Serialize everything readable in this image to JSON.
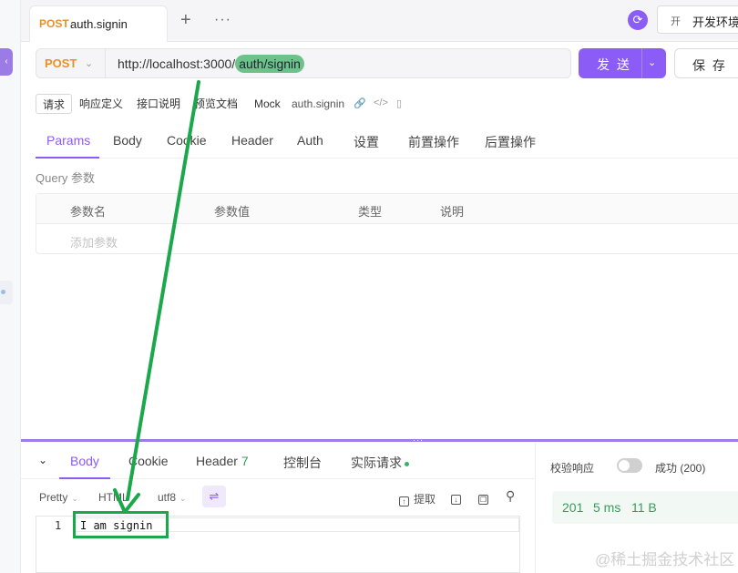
{
  "left_strip": {
    "button_glyph": "‹"
  },
  "tabbar": {
    "file_tab": {
      "method": "POST",
      "name": "auth.signin"
    },
    "add_glyph": "+",
    "more_glyph": "···",
    "sync_glyph": "⟳",
    "env": {
      "icon_text": "开",
      "label": "开发环境"
    }
  },
  "request": {
    "method": "POST",
    "chevron": "⌄",
    "url_base": "http://localhost:3000/",
    "url_path": "auth/signin",
    "send_label": "发 送",
    "save_label": "保 存"
  },
  "subtabs": [
    "请求",
    "响应定义",
    "接口说明",
    "预览文档",
    "Mock",
    "auth.signin"
  ],
  "subtab_icons": [
    "🔗",
    "</>",
    "▯"
  ],
  "req_tabs": [
    "Params",
    "Body",
    "Cookie",
    "Header",
    "Auth",
    "设置",
    "前置操作",
    "后置操作"
  ],
  "params": {
    "label": "Query 参数",
    "headers": [
      "参数名",
      "参数值",
      "类型",
      "说明"
    ],
    "placeholder": "添加参数"
  },
  "response": {
    "collapse_glyph": "⌄",
    "tabs": {
      "body": "Body",
      "cookie": "Cookie",
      "header": "Header",
      "header_count": "7",
      "console": "控制台",
      "actual": "实际请求"
    },
    "format": {
      "pretty": "Pretty",
      "type": "HTML",
      "encoding": "utf8"
    },
    "tools": {
      "extract": "提取"
    },
    "line_number": "1",
    "body_text": "I am signin"
  },
  "validate": {
    "label": "校验响应",
    "status": "成功 (200)",
    "status_code": "201",
    "time": "5 ms",
    "size": "11 B"
  },
  "watermark": "@稀土掘金技术社区",
  "colors": {
    "accent": "#8b5cf6",
    "method_post": "#e8902a",
    "annotation_green": "#1aa84a",
    "success_green": "#3a9b5c"
  },
  "icons": [
    "sync-icon",
    "chevron-down-icon",
    "link-icon",
    "code-icon",
    "layout-icon",
    "wrap-icon",
    "extract-icon",
    "download-icon",
    "copy-icon",
    "search-icon"
  ]
}
